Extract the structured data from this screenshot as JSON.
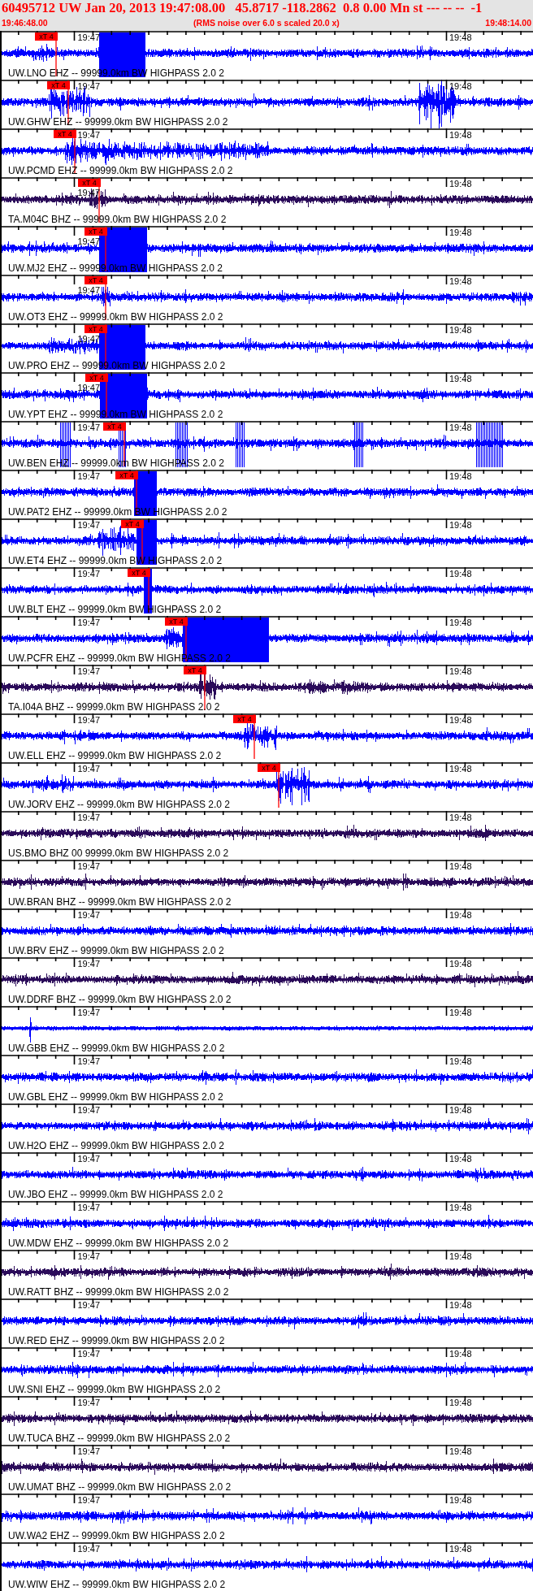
{
  "header": {
    "title": "60495712 UW Jan 20, 2013 19:47:08.00   45.8717 -118.2862  0.8 0.00 Mn st --- -- --  -1",
    "start_time": "19:46:48.00",
    "note": "(RMS noise over 6.0 s scaled 20.0 x)",
    "end_time": "19:48:14.00"
  },
  "traces": [
    {
      "label": "UW.LNO EHZ -- 99999.0km BW HIGHPASS 2.0 2",
      "color": "#0000ff",
      "times": [
        "19:47",
        "19:48"
      ],
      "pick": "xT 4"
    },
    {
      "label": "UW.GHW EHZ -- 99999.0km BW HIGHPASS 2.0 2",
      "color": "#0000ff",
      "times": [
        "19:47",
        "19:48"
      ],
      "pick": "xT 4"
    },
    {
      "label": "UW.PCMD EHZ -- 99999.0km BW HIGHPASS 2.0 2",
      "color": "#0000ff",
      "times": [
        "19:47",
        "19:48"
      ],
      "pick": "xT 4"
    },
    {
      "label": "TA.M04C BHZ -- 99999.0km BW HIGHPASS 2.0 2",
      "color": "#2b0b5a",
      "times": [
        "19:47",
        "19:48"
      ],
      "pick": "xT 4"
    },
    {
      "label": "UW.MJ2 EHZ -- 99999.0km BW HIGHPASS 2.0 2",
      "color": "#0000ff",
      "times": [
        "19:47",
        "19:48"
      ],
      "pick": "xT 4"
    },
    {
      "label": "UW.OT3 EHZ -- 99999.0km BW HIGHPASS 2.0 2",
      "color": "#0000ff",
      "times": [
        "19:47",
        "19:48"
      ],
      "pick": "xT 4"
    },
    {
      "label": "UW.PRO EHZ -- 99999.0km BW HIGHPASS 2.0 2",
      "color": "#0000ff",
      "times": [
        "19:47",
        "19:48"
      ],
      "pick": "xT 4"
    },
    {
      "label": "UW.YPT EHZ -- 99999.0km BW HIGHPASS 2.0 2",
      "color": "#0000ff",
      "times": [
        "19:47",
        "19:48"
      ],
      "pick": "xT 4"
    },
    {
      "label": "UW.BEN EHZ -- 99999.0km BW HIGHPASS 2.0 2",
      "color": "#0000ff",
      "times": [
        "19:47",
        "19:48"
      ],
      "pick": "xT 4"
    },
    {
      "label": "UW.PAT2 EHZ -- 99999.0km BW HIGHPASS 2.0 2",
      "color": "#0000ff",
      "times": [
        "19:47",
        "19:48"
      ],
      "pick": "xT 4"
    },
    {
      "label": "UW.ET4 EHZ -- 99999.0km BW HIGHPASS 2.0 2",
      "color": "#0000ff",
      "times": [
        "19:47",
        "19:48"
      ],
      "pick": "xT 4"
    },
    {
      "label": "UW.BLT EHZ -- 99999.0km BW HIGHPASS 2.0 2",
      "color": "#0000ff",
      "times": [
        "19:47",
        "19:48"
      ],
      "pick": "xT 4"
    },
    {
      "label": "UW.PCFR EHZ -- 99999.0km BW HIGHPASS 2.0 2",
      "color": "#0000ff",
      "times": [
        "19:47",
        "19:48"
      ],
      "pick": "xT 4"
    },
    {
      "label": "TA.I04A BHZ -- 99999.0km BW HIGHPASS 2.0 2",
      "color": "#2b0b5a",
      "times": [
        "19:47",
        "19:48"
      ],
      "pick": "xT 4"
    },
    {
      "label": "UW.ELL EHZ -- 99999.0km BW HIGHPASS 2.0 2",
      "color": "#0000ff",
      "times": [
        "19:47",
        "19:48"
      ],
      "pick": "xT 4"
    },
    {
      "label": "UW.JORV EHZ -- 99999.0km BW HIGHPASS 2.0 2",
      "color": "#0000ff",
      "times": [
        "19:47",
        "19:48"
      ],
      "pick": "xT 4"
    },
    {
      "label": "US.BMO BHZ 00 99999.0km BW HIGHPASS 2.0 2",
      "color": "#2b0b5a",
      "times": [
        "19:47",
        "19:48"
      ]
    },
    {
      "label": "UW.BRAN BHZ -- 99999.0km BW HIGHPASS 2.0 2",
      "color": "#2b0b5a",
      "times": [
        "19:47",
        "19:48"
      ]
    },
    {
      "label": "UW.BRV EHZ -- 99999.0km BW HIGHPASS 2.0 2",
      "color": "#0000ff",
      "times": [
        "19:47",
        "19:48"
      ]
    },
    {
      "label": "UW.DDRF BHZ -- 99999.0km BW HIGHPASS 2.0 2",
      "color": "#2b0b5a",
      "times": [
        "19:47",
        "19:48"
      ]
    },
    {
      "label": "UW.GBB EHZ -- 99999.0km BW HIGHPASS 2.0 2",
      "color": "#0000ff",
      "times": [
        "19:47",
        "19:48"
      ]
    },
    {
      "label": "UW.GBL EHZ -- 99999.0km BW HIGHPASS 2.0 2",
      "color": "#0000ff",
      "times": [
        "19:47",
        "19:48"
      ]
    },
    {
      "label": "UW.H2O EHZ -- 99999.0km BW HIGHPASS 2.0 2",
      "color": "#0000ff",
      "times": [
        "19:47",
        "19:48"
      ]
    },
    {
      "label": "UW.JBO EHZ -- 99999.0km BW HIGHPASS 2.0 2",
      "color": "#0000ff",
      "times": [
        "19:47",
        "19:48"
      ]
    },
    {
      "label": "UW.MDW EHZ -- 99999.0km BW HIGHPASS 2.0 2",
      "color": "#0000ff",
      "times": [
        "19:47",
        "19:48"
      ]
    },
    {
      "label": "UW.RATT BHZ -- 99999.0km BW HIGHPASS 2.0 2",
      "color": "#2b0b5a",
      "times": [
        "19:47",
        "19:48"
      ]
    },
    {
      "label": "UW.RED EHZ -- 99999.0km BW HIGHPASS 2.0 2",
      "color": "#0000ff",
      "times": [
        "19:47",
        "19:48"
      ]
    },
    {
      "label": "UW.SNI EHZ -- 99999.0km BW HIGHPASS 2.0 2",
      "color": "#0000ff",
      "times": [
        "19:47",
        "19:48"
      ]
    },
    {
      "label": "UW.TUCA BHZ -- 99999.0km BW HIGHPASS 2.0 2",
      "color": "#2b0b5a",
      "times": [
        "19:47",
        "19:48"
      ]
    },
    {
      "label": "UW.UMAT BHZ -- 99999.0km BW HIGHPASS 2.0 2",
      "color": "#2b0b5a",
      "times": [
        "19:47",
        "19:48"
      ]
    },
    {
      "label": "UW.WA2 EHZ -- 99999.0km BW HIGHPASS 2.0 2",
      "color": "#0000ff",
      "times": [
        "19:47",
        "19:48"
      ]
    },
    {
      "label": "UW.WIW EHZ -- 99999.0km BW HIGHPASS 2.0 2",
      "color": "#0000ff",
      "times": [
        "19:47",
        "19:48"
      ]
    }
  ]
}
